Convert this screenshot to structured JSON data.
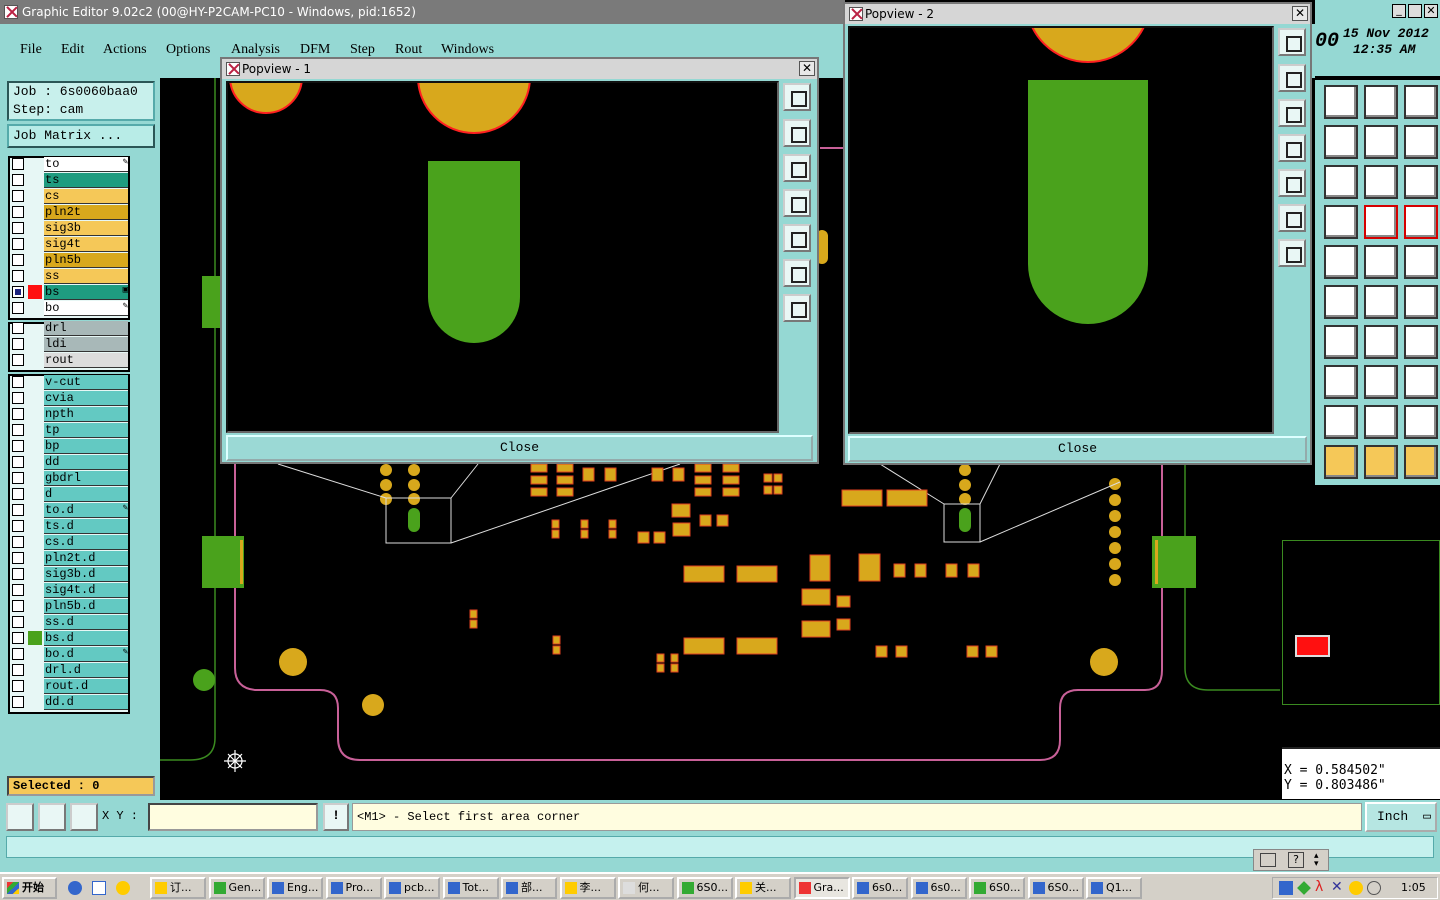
{
  "main_window": {
    "title": "Graphic Editor 9.02c2 (00@HY-P2CAM-PC10 - Windows, pid:1652)"
  },
  "menu": [
    "File",
    "Edit",
    "Actions",
    "Options",
    "Analysis",
    "DFM",
    "Step",
    "Rout",
    "Windows"
  ],
  "job": {
    "job_line": "Job : 6s0060baa0",
    "step_line": "Step: cam",
    "matrix_button": "Job Matrix ..."
  },
  "layers": [
    {
      "name": "to",
      "color": "#ffffff",
      "flag": "✎"
    },
    {
      "name": "ts",
      "color": "#1f9c80",
      "flag": ""
    },
    {
      "name": "cs",
      "color": "#f5c858",
      "flag": ""
    },
    {
      "name": "pln2t",
      "color": "#d8a81c",
      "flag": ""
    },
    {
      "name": "sig3b",
      "color": "#f5c858",
      "flag": ""
    },
    {
      "name": "sig4t",
      "color": "#f5c858",
      "flag": ""
    },
    {
      "name": "pln5b",
      "color": "#d8a81c",
      "flag": ""
    },
    {
      "name": "ss",
      "color": "#f5c858",
      "flag": ""
    },
    {
      "name": "bs",
      "color": "#1f9c80",
      "flag": "▣"
    },
    {
      "name": "bo",
      "color": "#ffffff",
      "flag": "✎"
    },
    {
      "name": "drl",
      "color": "#a8b8b8",
      "flag": ""
    },
    {
      "name": "ldi",
      "color": "#a8b8b8",
      "flag": ""
    },
    {
      "name": "rout",
      "color": "#dcdcdc",
      "flag": ""
    },
    {
      "name": "v-cut",
      "color": "#63c9c2",
      "flag": ""
    },
    {
      "name": "cvia",
      "color": "#63c9c2",
      "flag": ""
    },
    {
      "name": "npth",
      "color": "#63c9c2",
      "flag": ""
    },
    {
      "name": "tp",
      "color": "#63c9c2",
      "flag": ""
    },
    {
      "name": "bp",
      "color": "#63c9c2",
      "flag": ""
    },
    {
      "name": "dd",
      "color": "#63c9c2",
      "flag": ""
    },
    {
      "name": "gbdrl",
      "color": "#63c9c2",
      "flag": ""
    },
    {
      "name": "d",
      "color": "#63c9c2",
      "flag": ""
    },
    {
      "name": "to.d",
      "color": "#63c9c2",
      "flag": "✎"
    },
    {
      "name": "ts.d",
      "color": "#63c9c2",
      "flag": ""
    },
    {
      "name": "cs.d",
      "color": "#63c9c2",
      "flag": ""
    },
    {
      "name": "pln2t.d",
      "color": "#63c9c2",
      "flag": ""
    },
    {
      "name": "sig3b.d",
      "color": "#63c9c2",
      "flag": ""
    },
    {
      "name": "sig4t.d",
      "color": "#63c9c2",
      "flag": ""
    },
    {
      "name": "pln5b.d",
      "color": "#63c9c2",
      "flag": ""
    },
    {
      "name": "ss.d",
      "color": "#63c9c2",
      "flag": ""
    },
    {
      "name": "bs.d",
      "color": "#63c9c2",
      "flag": ""
    },
    {
      "name": "bo.d",
      "color": "#63c9c2",
      "flag": "✎"
    },
    {
      "name": "drl.d",
      "color": "#63c9c2",
      "flag": ""
    },
    {
      "name": "rout.d",
      "color": "#63c9c2",
      "flag": ""
    },
    {
      "name": "dd.d",
      "color": "#63c9c2",
      "flag": ""
    }
  ],
  "selected_count": "Selected : 0",
  "popview1": {
    "title": "Popview - 1",
    "close_label": "Close"
  },
  "popview2": {
    "title": "Popview - 2",
    "close_label": "Close"
  },
  "clock": {
    "time_prefix": "00",
    "date": "15 Nov 2012",
    "time": "12:35 AM"
  },
  "coords": {
    "x": "X = 0.584502\"",
    "y": "Y = 0.803486\""
  },
  "status": {
    "xy_label": "X Y :",
    "xy_value": "",
    "prompt": "<M1> - Select first area corner",
    "units": "Inch"
  },
  "taskbar": {
    "start": "开始",
    "items": [
      "订...",
      "Gen...",
      "Eng...",
      "Pro...",
      "pcb...",
      "Tot...",
      "部...",
      "李...",
      "何...",
      "6S0...",
      "关...",
      "Gra...",
      "6s0...",
      "6s0...",
      "6S0...",
      "6S0...",
      "Q1..."
    ],
    "active_index": 11,
    "clock": "1:05"
  },
  "colors": {
    "panel": "#95d8d3",
    "copper": "#d8a81c",
    "soldermask": "#4aa21c",
    "outline_red": "#ff2020"
  }
}
